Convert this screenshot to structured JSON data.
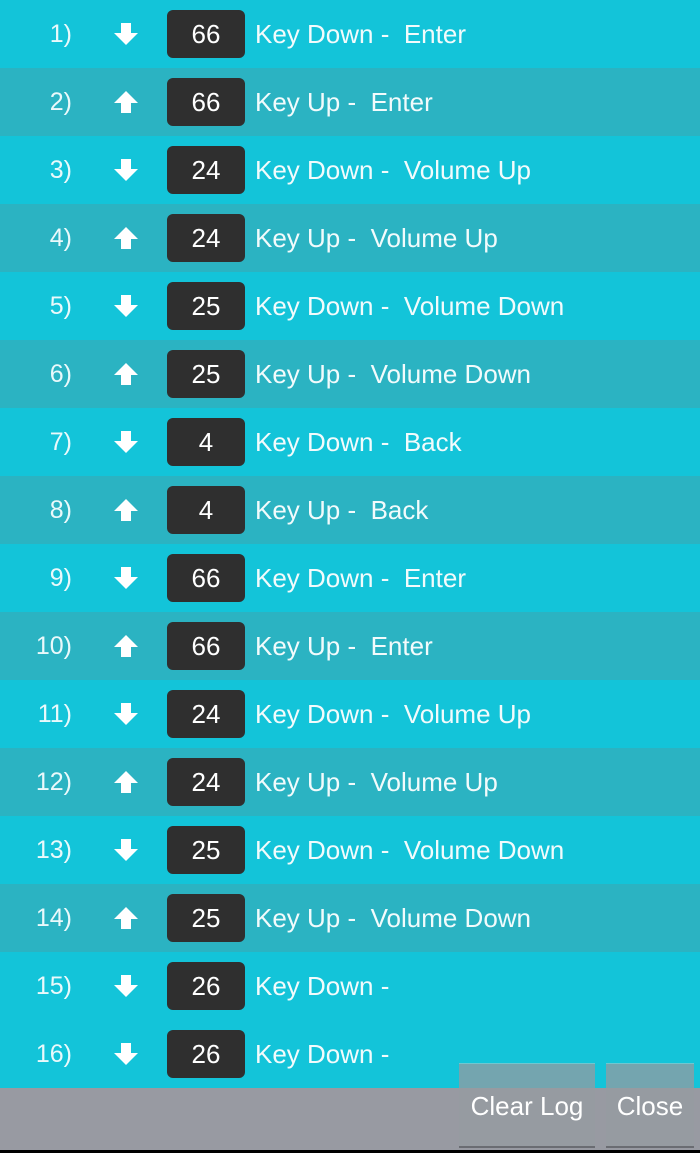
{
  "colors": {
    "row_light": "#13c4d9",
    "row_dark": "#2bb3c2",
    "code_bg": "#2f2f2f",
    "footer": "#989aa2"
  },
  "log": [
    {
      "index": "1)",
      "direction": "down",
      "icon": "arrow-down-icon",
      "code": "66",
      "text": "Key Down -  Enter",
      "shade": "light"
    },
    {
      "index": "2)",
      "direction": "up",
      "icon": "arrow-up-icon",
      "code": "66",
      "text": "Key Up -  Enter",
      "shade": "dark"
    },
    {
      "index": "3)",
      "direction": "down",
      "icon": "arrow-down-icon",
      "code": "24",
      "text": "Key Down -  Volume Up",
      "shade": "light"
    },
    {
      "index": "4)",
      "direction": "up",
      "icon": "arrow-up-icon",
      "code": "24",
      "text": "Key Up -  Volume Up",
      "shade": "dark"
    },
    {
      "index": "5)",
      "direction": "down",
      "icon": "arrow-down-icon",
      "code": "25",
      "text": "Key Down -  Volume Down",
      "shade": "light"
    },
    {
      "index": "6)",
      "direction": "up",
      "icon": "arrow-up-icon",
      "code": "25",
      "text": "Key Up -  Volume Down",
      "shade": "dark"
    },
    {
      "index": "7)",
      "direction": "down",
      "icon": "arrow-down-icon",
      "code": "4",
      "text": "Key Down -  Back",
      "shade": "light"
    },
    {
      "index": "8)",
      "direction": "up",
      "icon": "arrow-up-icon",
      "code": "4",
      "text": "Key Up -  Back",
      "shade": "dark"
    },
    {
      "index": "9)",
      "direction": "down",
      "icon": "arrow-down-icon",
      "code": "66",
      "text": "Key Down -  Enter",
      "shade": "light"
    },
    {
      "index": "10)",
      "direction": "up",
      "icon": "arrow-up-icon",
      "code": "66",
      "text": "Key Up -  Enter",
      "shade": "dark"
    },
    {
      "index": "11)",
      "direction": "down",
      "icon": "arrow-down-icon",
      "code": "24",
      "text": "Key Down -  Volume Up",
      "shade": "light"
    },
    {
      "index": "12)",
      "direction": "up",
      "icon": "arrow-up-icon",
      "code": "24",
      "text": "Key Up -  Volume Up",
      "shade": "dark"
    },
    {
      "index": "13)",
      "direction": "down",
      "icon": "arrow-down-icon",
      "code": "25",
      "text": "Key Down -  Volume Down",
      "shade": "light"
    },
    {
      "index": "14)",
      "direction": "up",
      "icon": "arrow-up-icon",
      "code": "25",
      "text": "Key Up -  Volume Down",
      "shade": "dark"
    },
    {
      "index": "15)",
      "direction": "down",
      "icon": "arrow-down-icon",
      "code": "26",
      "text": "Key Down - ",
      "shade": "light"
    },
    {
      "index": "16)",
      "direction": "down",
      "icon": "arrow-down-icon",
      "code": "26",
      "text": "Key Down - ",
      "shade": "light"
    }
  ],
  "buttons": {
    "clear_log": "Clear Log",
    "close": "Close"
  }
}
